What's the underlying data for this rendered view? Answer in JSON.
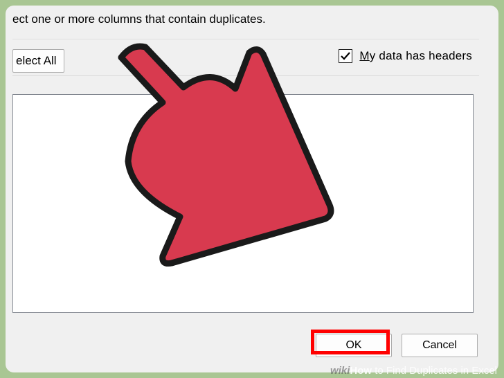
{
  "instruction": "ect one or more columns that contain duplicates.",
  "buttons": {
    "select_all": "elect All",
    "ok": "OK",
    "cancel": "Cancel"
  },
  "checkbox": {
    "headers_label_prefix": "M",
    "headers_label_rest": "y data has headers",
    "checked": true
  },
  "watermark": {
    "wiki": "wiki",
    "how": "How",
    "title": " to Find Duplicates in Excel"
  },
  "colors": {
    "highlight": "#ff0000",
    "arrow_fill": "#d83a4f",
    "arrow_stroke": "#1a1a1a"
  }
}
